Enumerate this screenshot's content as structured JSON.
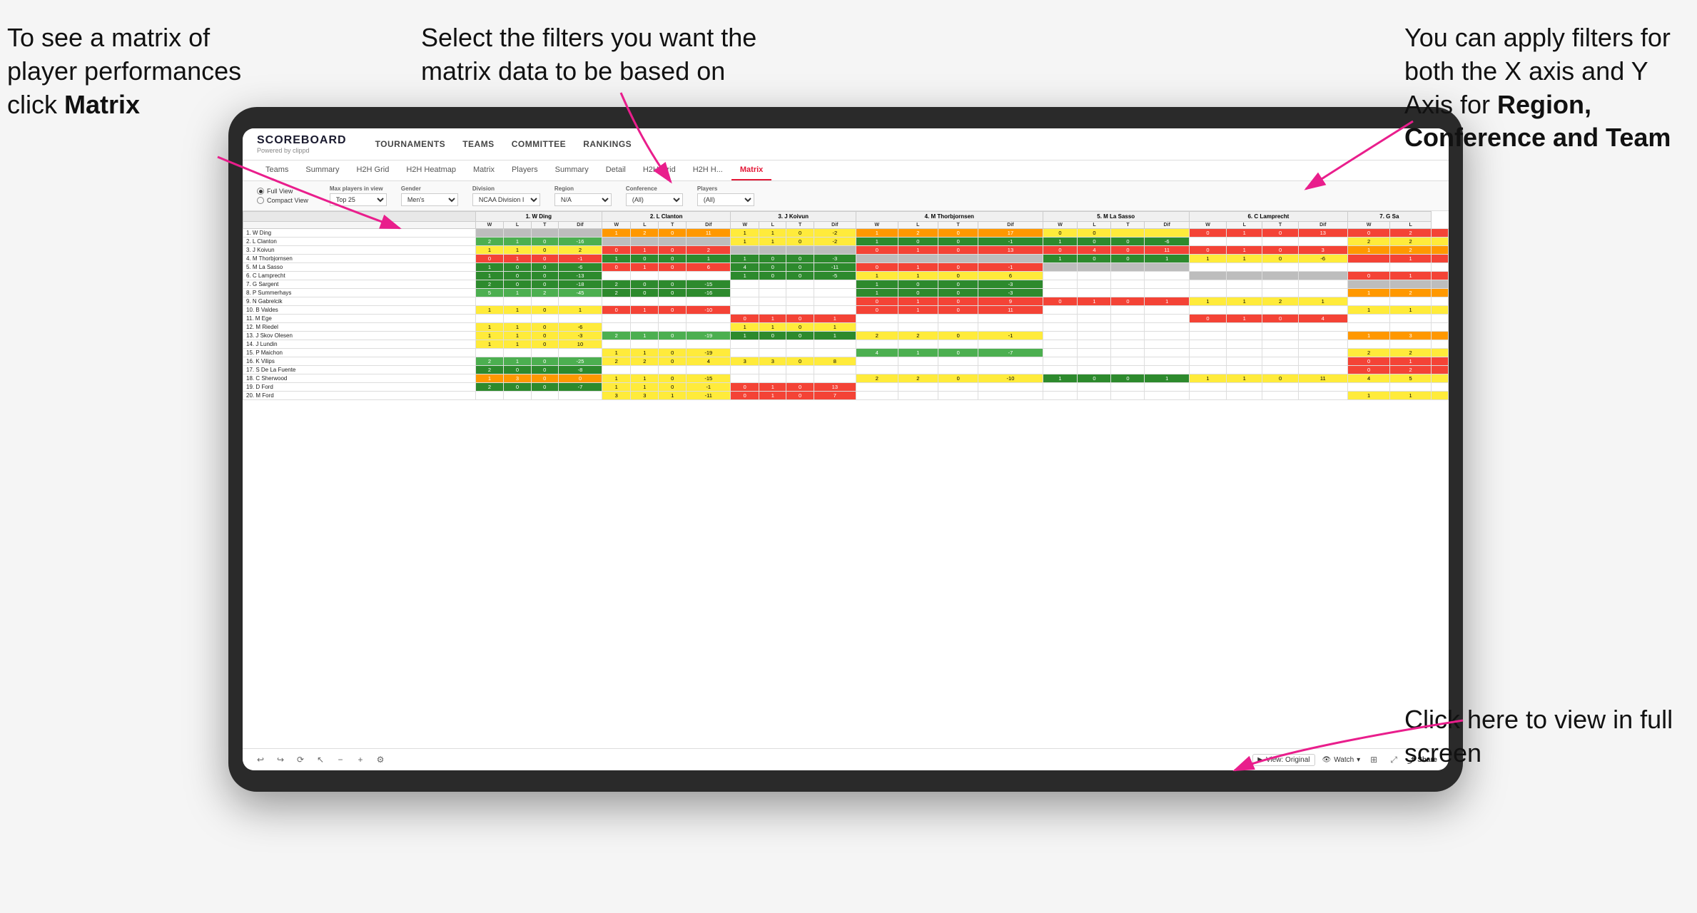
{
  "annotations": {
    "topleft": "To see a matrix of player performances click Matrix",
    "topleft_bold": "Matrix",
    "topmid": "Select the filters you want the matrix data to be based on",
    "topright_line1": "You  can apply filters for both the X axis and Y Axis for ",
    "topright_bold": "Region, Conference and Team",
    "bottomright_line1": "Click here to view in full screen"
  },
  "nav": {
    "logo": "SCOREBOARD",
    "logo_sub": "Powered by clippd",
    "items": [
      "TOURNAMENTS",
      "TEAMS",
      "COMMITTEE",
      "RANKINGS"
    ]
  },
  "subtabs": {
    "items": [
      "Teams",
      "Summary",
      "H2H Grid",
      "H2H Heatmap",
      "Matrix",
      "Players",
      "Summary",
      "Detail",
      "H2H Grid",
      "H2H H...",
      "Matrix"
    ],
    "active_index": 10
  },
  "filters": {
    "view_options": [
      "Full View",
      "Compact View"
    ],
    "active_view": 0,
    "groups": [
      {
        "label": "Max players in view",
        "value": "Top 25"
      },
      {
        "label": "Gender",
        "value": "Men's"
      },
      {
        "label": "Division",
        "value": "NCAA Division I"
      },
      {
        "label": "Region",
        "value": "N/A"
      },
      {
        "label": "Conference",
        "value": "(All)"
      },
      {
        "label": "Players",
        "value": "(All)"
      }
    ]
  },
  "matrix": {
    "col_headers": [
      "1. W Ding",
      "2. L Clanton",
      "3. J Koivun",
      "4. M Thorbjornsen",
      "5. M La Sasso",
      "6. C Lamprecht",
      "7. G Sa"
    ],
    "col_subheaders": [
      "W",
      "L",
      "T",
      "Dif"
    ],
    "rows": [
      {
        "name": "1. W Ding",
        "cells": [
          [
            null,
            null,
            null,
            null
          ],
          [
            1,
            2,
            0,
            11
          ],
          [
            1,
            1,
            0,
            "-2"
          ],
          [
            1,
            2,
            0,
            17
          ],
          [
            0,
            0,
            null,
            null
          ],
          [
            0,
            1,
            0,
            13
          ],
          [
            0,
            2,
            null
          ]
        ]
      },
      {
        "name": "2. L Clanton",
        "cells": [
          [
            2,
            1,
            0,
            "-16"
          ],
          [
            null,
            null,
            null,
            null
          ],
          [
            1,
            1,
            0,
            "-2"
          ],
          [
            1,
            0,
            0,
            "-1"
          ],
          [
            1,
            0,
            0,
            "-6"
          ],
          [
            null,
            null,
            null,
            null
          ],
          [
            2,
            2,
            null
          ]
        ]
      },
      {
        "name": "3. J Koivun",
        "cells": [
          [
            1,
            1,
            0,
            2
          ],
          [
            0,
            1,
            0,
            2
          ],
          [
            null,
            null,
            null,
            null
          ],
          [
            0,
            1,
            0,
            13
          ],
          [
            0,
            4,
            0,
            11
          ],
          [
            0,
            1,
            0,
            3
          ],
          [
            1,
            2,
            null
          ]
        ]
      },
      {
        "name": "4. M Thorbjornsen",
        "cells": [
          [
            0,
            1,
            0,
            "-1"
          ],
          [
            1,
            0,
            0,
            1
          ],
          [
            1,
            0,
            0,
            "-3"
          ],
          [
            null,
            null,
            null,
            null
          ],
          [
            1,
            0,
            0,
            1
          ],
          [
            1,
            1,
            0,
            "-6"
          ],
          [
            null,
            1,
            null
          ]
        ]
      },
      {
        "name": "5. M La Sasso",
        "cells": [
          [
            1,
            0,
            0,
            "-6"
          ],
          [
            0,
            1,
            0,
            6
          ],
          [
            4,
            0,
            0,
            "-11"
          ],
          [
            0,
            1,
            0,
            "-1"
          ],
          [
            null,
            null,
            null,
            null
          ],
          [
            null,
            null,
            null,
            null
          ],
          [
            null,
            null,
            null
          ]
        ]
      },
      {
        "name": "6. C Lamprecht",
        "cells": [
          [
            1,
            0,
            0,
            "-13"
          ],
          [
            null,
            null,
            null,
            null
          ],
          [
            1,
            0,
            0,
            "-5"
          ],
          [
            1,
            1,
            0,
            6
          ],
          [
            null,
            null,
            null,
            null
          ],
          [
            null,
            null,
            null,
            null
          ],
          [
            0,
            1,
            null
          ]
        ]
      },
      {
        "name": "7. G Sargent",
        "cells": [
          [
            2,
            0,
            0,
            "-18"
          ],
          [
            2,
            0,
            0,
            "-15"
          ],
          [
            null,
            null,
            null,
            null
          ],
          [
            1,
            0,
            0,
            "-3"
          ],
          [
            null,
            null,
            null,
            null
          ],
          [
            null,
            null,
            null,
            null
          ],
          [
            null,
            null,
            null
          ]
        ]
      },
      {
        "name": "8. P Summerhays",
        "cells": [
          [
            5,
            1,
            2,
            "-45"
          ],
          [
            2,
            0,
            0,
            "-16"
          ],
          [
            null,
            null,
            null,
            null
          ],
          [
            1,
            0,
            0,
            "-3"
          ],
          [
            null,
            null,
            null,
            null
          ],
          [
            null,
            null,
            null,
            null
          ],
          [
            1,
            2,
            null
          ]
        ]
      },
      {
        "name": "9. N Gabrelcik",
        "cells": [
          [
            null,
            null,
            null,
            null
          ],
          [
            null,
            null,
            null,
            null
          ],
          [
            null,
            null,
            null,
            null
          ],
          [
            0,
            1,
            0,
            9
          ],
          [
            0,
            1,
            0,
            1
          ],
          [
            1,
            1,
            2,
            1
          ],
          [
            null,
            null,
            null
          ]
        ]
      },
      {
        "name": "10. B Valdes",
        "cells": [
          [
            1,
            1,
            0,
            1
          ],
          [
            0,
            1,
            0,
            "-10"
          ],
          [
            null,
            null,
            null,
            null
          ],
          [
            0,
            1,
            0,
            11
          ],
          [
            null,
            null,
            null,
            null
          ],
          [
            null,
            null,
            null,
            null
          ],
          [
            1,
            1,
            null
          ]
        ]
      },
      {
        "name": "11. M Ege",
        "cells": [
          [
            null,
            null,
            null,
            null
          ],
          [
            null,
            null,
            null,
            null
          ],
          [
            0,
            1,
            0,
            1
          ],
          [
            null,
            null,
            null,
            null
          ],
          [
            null,
            null,
            null,
            null
          ],
          [
            0,
            1,
            0,
            4
          ],
          [
            null,
            null,
            null
          ]
        ]
      },
      {
        "name": "12. M Riedel",
        "cells": [
          [
            1,
            1,
            0,
            "-6"
          ],
          [
            null,
            null,
            null,
            null
          ],
          [
            1,
            1,
            0,
            1
          ],
          [
            null,
            null,
            null,
            null
          ],
          [
            null,
            null,
            null,
            null
          ],
          [
            null,
            null,
            null,
            null
          ],
          [
            null,
            null,
            null
          ]
        ]
      },
      {
        "name": "13. J Skov Olesen",
        "cells": [
          [
            1,
            1,
            0,
            "-3"
          ],
          [
            2,
            1,
            0,
            "-19"
          ],
          [
            1,
            0,
            0,
            1
          ],
          [
            2,
            2,
            0,
            "-1"
          ],
          [
            null,
            null,
            null,
            null
          ],
          [
            null,
            null,
            null,
            null
          ],
          [
            1,
            3,
            null
          ]
        ]
      },
      {
        "name": "14. J Lundin",
        "cells": [
          [
            1,
            1,
            0,
            10
          ],
          [
            null,
            null,
            null,
            null
          ],
          [
            null,
            null,
            null,
            null
          ],
          [
            null,
            null,
            null,
            null
          ],
          [
            null,
            null,
            null,
            null
          ],
          [
            null,
            null,
            null,
            null
          ],
          [
            null,
            null,
            null
          ]
        ]
      },
      {
        "name": "15. P Maichon",
        "cells": [
          [
            null,
            null,
            null,
            null
          ],
          [
            1,
            1,
            0,
            "-19"
          ],
          [
            null,
            null,
            null,
            null
          ],
          [
            4,
            1,
            0,
            "-7"
          ],
          [
            null,
            null,
            null,
            null
          ],
          [
            null,
            null,
            null,
            null
          ],
          [
            2,
            2,
            null
          ]
        ]
      },
      {
        "name": "16. K Vilips",
        "cells": [
          [
            2,
            1,
            0,
            "-25"
          ],
          [
            2,
            2,
            0,
            4
          ],
          [
            3,
            3,
            0,
            8
          ],
          [
            null,
            null,
            null,
            null
          ],
          [
            null,
            null,
            null,
            null
          ],
          [
            null,
            null,
            null,
            null
          ],
          [
            0,
            1,
            null
          ]
        ]
      },
      {
        "name": "17. S De La Fuente",
        "cells": [
          [
            2,
            0,
            0,
            "-8"
          ],
          [
            null,
            null,
            null,
            null
          ],
          [
            null,
            null,
            null,
            null
          ],
          [
            null,
            null,
            null,
            null
          ],
          [
            null,
            null,
            null,
            null
          ],
          [
            null,
            null,
            null,
            null
          ],
          [
            0,
            2,
            null
          ]
        ]
      },
      {
        "name": "18. C Sherwood",
        "cells": [
          [
            1,
            3,
            0,
            0
          ],
          [
            1,
            1,
            0,
            "-15"
          ],
          [
            null,
            null,
            null,
            null
          ],
          [
            2,
            2,
            0,
            "-10"
          ],
          [
            1,
            0,
            0,
            1
          ],
          [
            1,
            1,
            0,
            11
          ],
          [
            4,
            5,
            null
          ]
        ]
      },
      {
        "name": "19. D Ford",
        "cells": [
          [
            2,
            0,
            0,
            "-7"
          ],
          [
            1,
            1,
            0,
            "-1"
          ],
          [
            0,
            1,
            0,
            13
          ],
          [
            null,
            null,
            null,
            null
          ],
          [
            null,
            null,
            null,
            null
          ],
          [
            null,
            null,
            null,
            null
          ],
          [
            null,
            null,
            null
          ]
        ]
      },
      {
        "name": "20. M Ford",
        "cells": [
          [
            null,
            null,
            null,
            null
          ],
          [
            3,
            3,
            1,
            "-11"
          ],
          [
            0,
            1,
            0,
            7
          ],
          [
            null,
            null,
            null,
            null
          ],
          [
            null,
            null,
            null,
            null
          ],
          [
            null,
            null,
            null,
            null
          ],
          [
            1,
            1,
            null
          ]
        ]
      }
    ]
  },
  "toolbar": {
    "view_original": "View: Original",
    "watch": "Watch",
    "share": "Share"
  }
}
